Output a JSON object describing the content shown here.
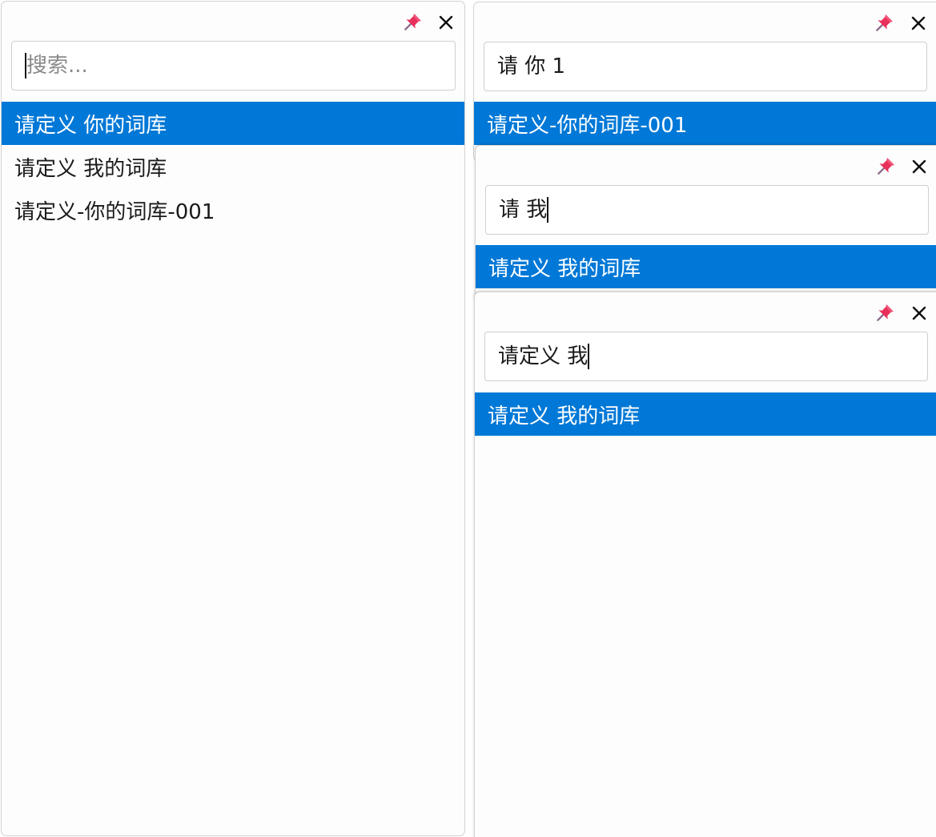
{
  "panels": [
    {
      "search": {
        "value": "",
        "placeholder": "搜索..."
      },
      "results": [
        {
          "label": "请定义 你的词库",
          "selected": true
        },
        {
          "label": "请定义 我的词库",
          "selected": false
        },
        {
          "label": "请定义-你的词库-001",
          "selected": false
        }
      ]
    },
    {
      "search": {
        "value": "请 你 1",
        "placeholder": ""
      },
      "results": [
        {
          "label": "请定义-你的词库-001",
          "selected": true
        }
      ]
    },
    {
      "search": {
        "value": "请 我",
        "placeholder": ""
      },
      "results": [
        {
          "label": "请定义 我的词库",
          "selected": true
        }
      ]
    },
    {
      "search": {
        "value": "请定义 我",
        "placeholder": ""
      },
      "results": [
        {
          "label": "请定义 我的词库",
          "selected": true
        }
      ]
    }
  ],
  "icons": {
    "pin": "pushpin-icon",
    "close": "close-icon"
  },
  "colors": {
    "selection": "#0078d7",
    "pin": "#e8305a"
  }
}
